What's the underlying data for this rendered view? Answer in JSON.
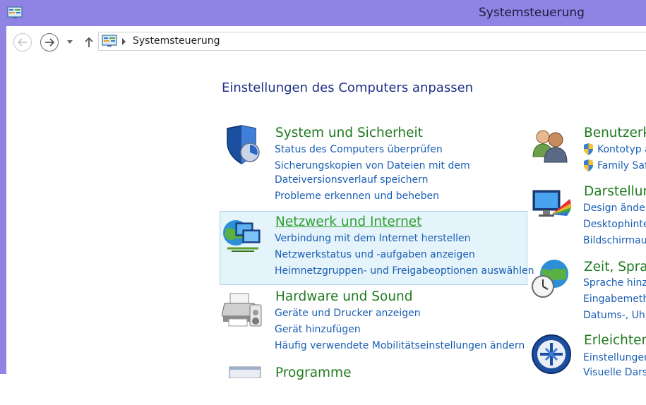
{
  "window": {
    "title": "Systemsteuerung"
  },
  "address_bar": {
    "breadcrumb": "Systemsteuerung"
  },
  "main": {
    "heading": "Einstellungen des Computers anpassen",
    "categories": [
      {
        "title": "System und Sicherheit",
        "links": [
          "Status des Computers überprüfen",
          "Sicherungskopien von Dateien mit dem",
          "Dateiversionsverlauf speichern",
          "Probleme erkennen und beheben"
        ]
      },
      {
        "title": "Netzwerk und Internet",
        "links": [
          "Verbindung mit dem Internet herstellen",
          "Netzwerkstatus und -aufgaben anzeigen",
          "Heimnetzgruppen- und Freigabeoptionen auswählen"
        ]
      },
      {
        "title": "Hardware und Sound",
        "links": [
          "Geräte und Drucker anzeigen",
          "Gerät hinzufügen",
          "Häufig verwendete Mobilitätseinstellungen ändern"
        ]
      },
      {
        "title": "Programme",
        "links": []
      },
      {
        "title": "Benutzerko",
        "links": [
          "Kontotyp ä",
          "Family Safe"
        ]
      },
      {
        "title": "Darstellung",
        "links": [
          "Design änder",
          "Desktophinte",
          "Bildschirmau"
        ]
      },
      {
        "title": "Zeit, Sprac",
        "links": [
          "Sprache hinzu",
          "Eingabemeth",
          "Datums-, Uhrz"
        ]
      },
      {
        "title": "Erleichtert",
        "links": [
          "Einstellungen",
          "Visuelle Darst"
        ]
      }
    ]
  },
  "colors": {
    "titlebar": "#8f84e3",
    "category_title": "#1e7a1e",
    "link": "#1a5fb4",
    "heading": "#1e3287",
    "highlight": "#e5f3fb"
  }
}
